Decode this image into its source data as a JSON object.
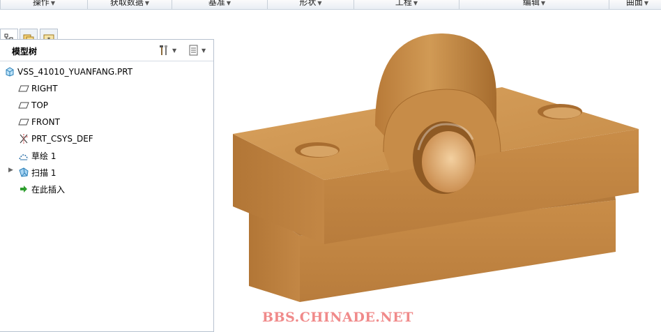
{
  "menubar": {
    "groups": [
      "操作",
      "获取数据",
      "基准",
      "形状",
      "工程",
      "编辑",
      "曲面"
    ]
  },
  "navigator": {
    "tabs": [
      "model-tree-tab",
      "folder-browser-tab",
      "favorites-tab"
    ]
  },
  "model_tree": {
    "title": "模型树",
    "items": [
      {
        "label": "VSS_41010_YUANFANG.PRT",
        "icon": "part-icon"
      },
      {
        "label": "RIGHT",
        "icon": "datum-plane-icon"
      },
      {
        "label": "TOP",
        "icon": "datum-plane-icon"
      },
      {
        "label": "FRONT",
        "icon": "datum-plane-icon"
      },
      {
        "label": "PRT_CSYS_DEF",
        "icon": "coordinate-system-icon"
      },
      {
        "label": "草绘 1",
        "icon": "sketch-icon"
      },
      {
        "label": "扫描 1",
        "icon": "sweep-icon",
        "expandable": true
      },
      {
        "label": "在此插入",
        "icon": "insert-here-arrow-icon"
      }
    ]
  },
  "viewport": {
    "watermark": "BBS.CHINADE.NET",
    "model_color": "#c68a45"
  }
}
